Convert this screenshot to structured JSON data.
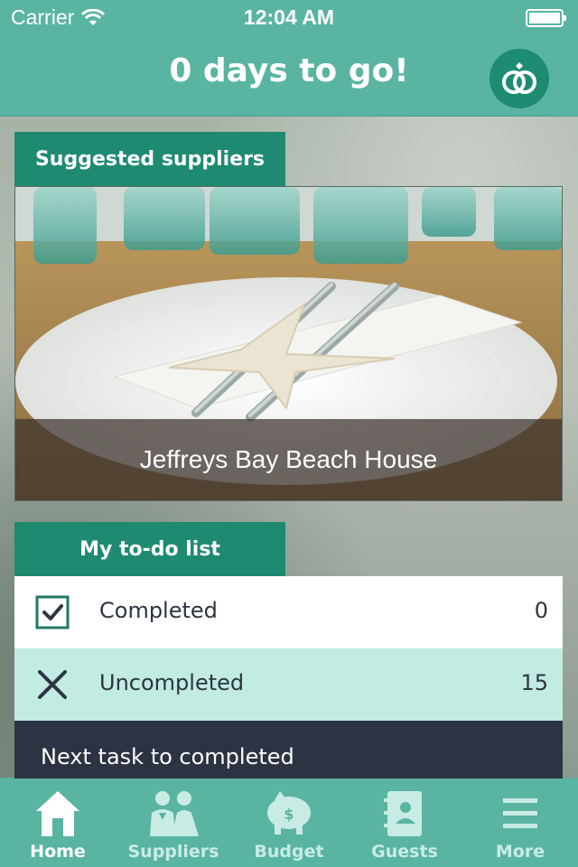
{
  "status_bar": {
    "carrier": "Carrier",
    "time": "12:04 AM"
  },
  "header": {
    "title": "0 days to go!",
    "right_icon": "wedding-rings-icon"
  },
  "suggested": {
    "tab_label": "Suggested suppliers",
    "supplier_name": "Jeffreys Bay Beach House"
  },
  "todo": {
    "tab_label": "My to-do list",
    "rows": [
      {
        "label": "Completed",
        "count": "0",
        "icon": "checkbox-checked-icon"
      },
      {
        "label": "Uncompleted",
        "count": "15",
        "icon": "cross-icon"
      }
    ],
    "next_task_label": "Next task to completed"
  },
  "tab_bar": {
    "items": [
      {
        "label": "Home",
        "icon": "home-icon",
        "active": true
      },
      {
        "label": "Suppliers",
        "icon": "couple-icon",
        "active": false
      },
      {
        "label": "Budget",
        "icon": "piggy-bank-icon",
        "active": false
      },
      {
        "label": "Guests",
        "icon": "address-book-icon",
        "active": false
      },
      {
        "label": "More",
        "icon": "menu-icon",
        "active": false
      }
    ]
  },
  "colors": {
    "brand": "#5ab4a2",
    "tab_dark": "#1f8a72",
    "uncompleted_bg": "#c2ebe2",
    "next_task_bg": "#2c3343"
  }
}
